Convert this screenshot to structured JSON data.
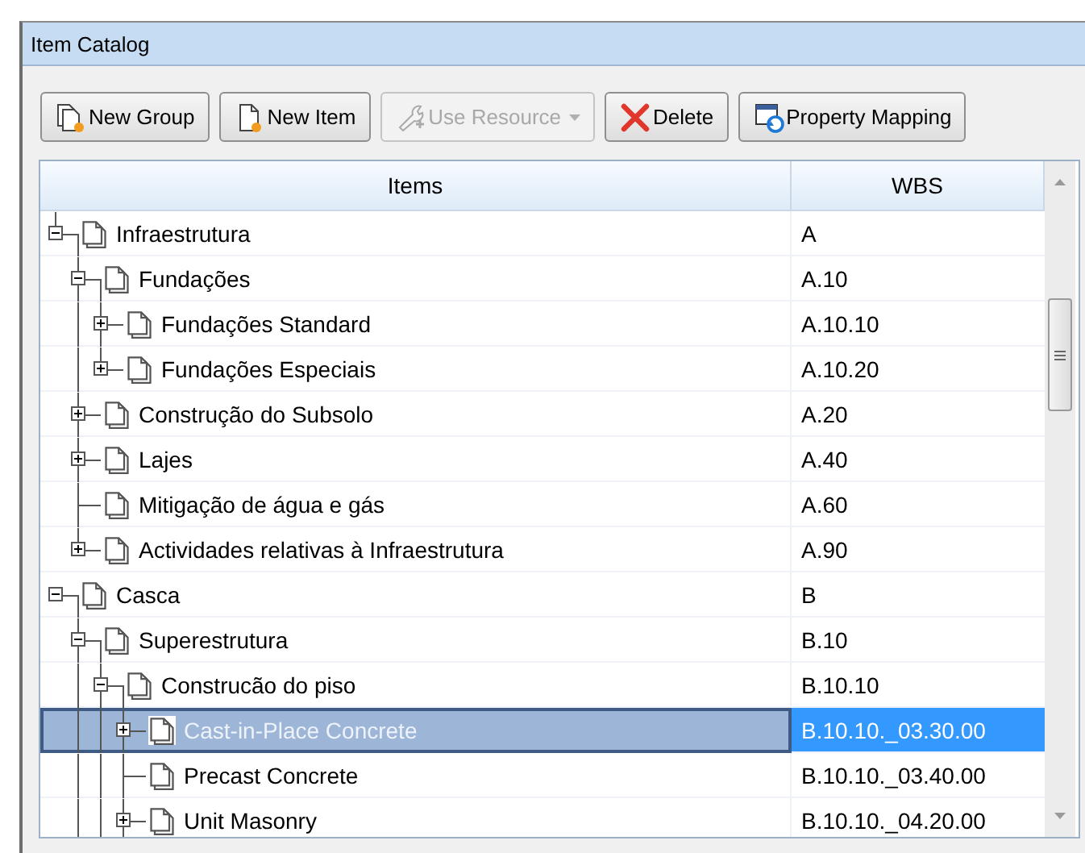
{
  "window": {
    "title": "Item Catalog"
  },
  "toolbar": [
    {
      "label": "New Group",
      "kind": "new-group",
      "disabled": false
    },
    {
      "label": "New Item",
      "kind": "new-item",
      "disabled": false
    },
    {
      "label": "Use Resource",
      "kind": "use-resource",
      "disabled": true,
      "dropdown": true
    },
    {
      "label": "Delete",
      "kind": "delete",
      "disabled": false
    },
    {
      "label": "Property Mapping",
      "kind": "property-mapping",
      "disabled": false
    }
  ],
  "table": {
    "columns": [
      "Items",
      "WBS"
    ],
    "rows": [
      {
        "name": "Infraestrutura",
        "wbs": "A",
        "expanded": true,
        "selected": false,
        "children": [
          {
            "name": "Fundações",
            "wbs": "A.10",
            "expanded": true,
            "selected": false,
            "children": [
              {
                "name": "Fundações Standard",
                "wbs": "A.10.10",
                "expanded": false,
                "selected": false
              },
              {
                "name": "Fundações Especiais",
                "wbs": "A.10.20",
                "expanded": false,
                "selected": false
              }
            ]
          },
          {
            "name": "Construção do Subsolo",
            "wbs": "A.20",
            "expanded": false,
            "selected": false
          },
          {
            "name": "Lajes",
            "wbs": "A.40",
            "expanded": false,
            "selected": false
          },
          {
            "name": "Mitigação de água e gás",
            "wbs": "A.60",
            "selected": false
          },
          {
            "name": "Actividades relativas à Infraestrutura",
            "wbs": "A.90",
            "expanded": false,
            "selected": false
          }
        ]
      },
      {
        "name": "Casca",
        "wbs": "B",
        "expanded": true,
        "selected": false,
        "children": [
          {
            "name": "Superestrutura",
            "wbs": "B.10",
            "expanded": true,
            "selected": false,
            "children": [
              {
                "name": "Construcão do piso",
                "wbs": "B.10.10",
                "expanded": true,
                "selected": false,
                "children": [
                  {
                    "name": "Cast-in-Place Concrete",
                    "wbs": "B.10.10._03.30.00",
                    "expanded": false,
                    "selected": true
                  },
                  {
                    "name": "Precast Concrete",
                    "wbs": "B.10.10._03.40.00",
                    "selected": false
                  },
                  {
                    "name": "Unit Masonry",
                    "wbs": "B.10.10._04.20.00",
                    "expanded": false,
                    "selected": false
                  }
                ]
              }
            ]
          }
        ]
      }
    ]
  }
}
